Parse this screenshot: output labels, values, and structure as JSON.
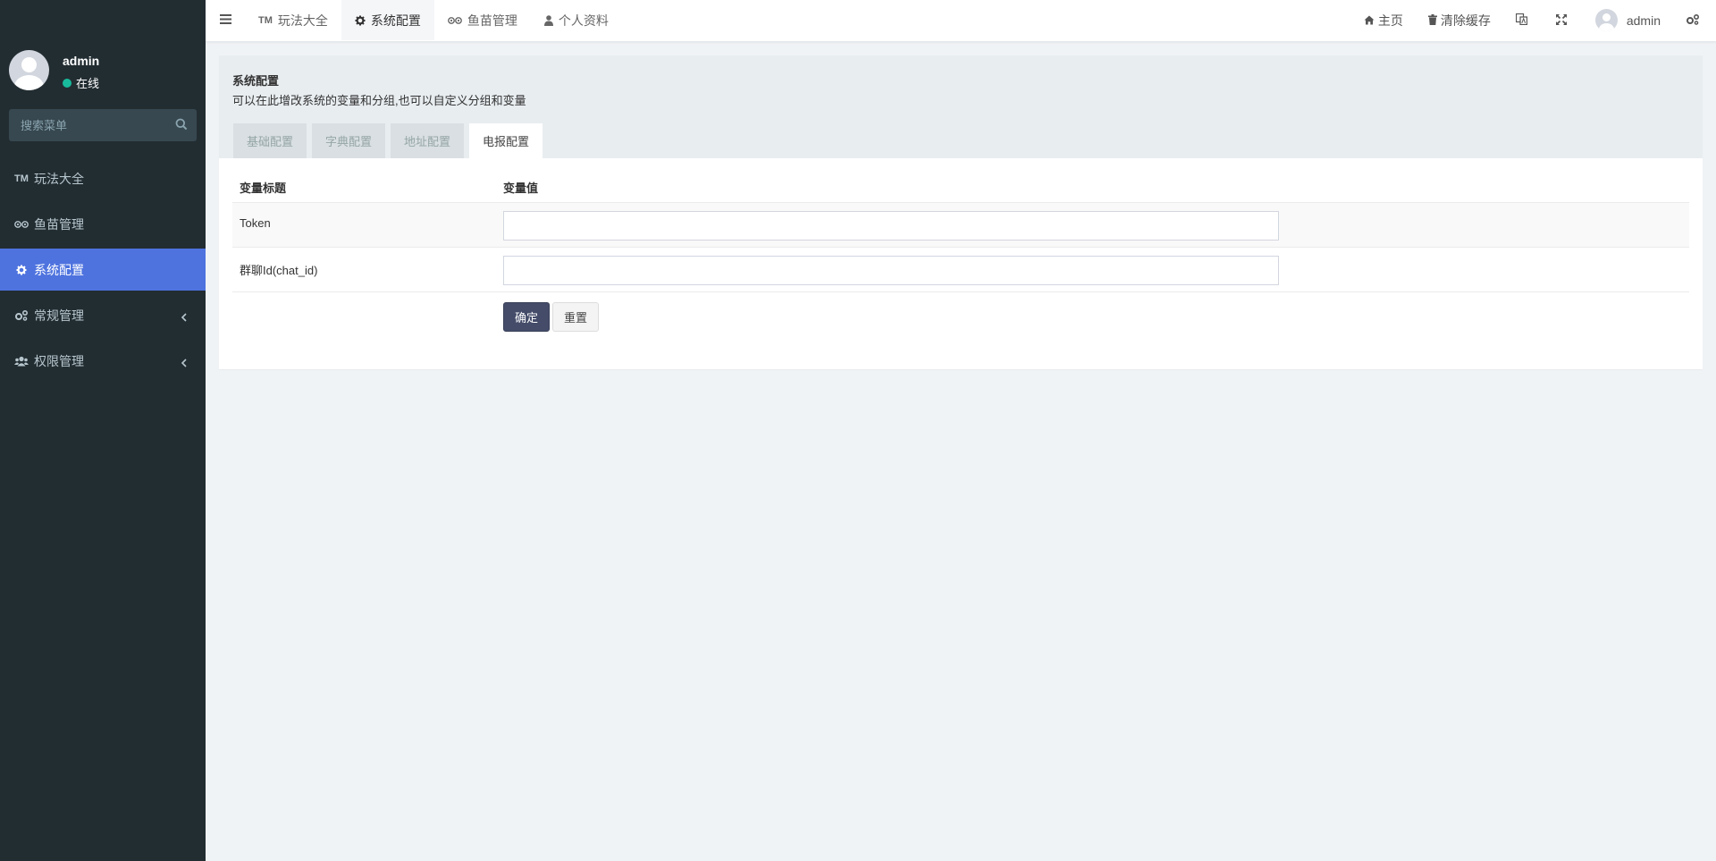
{
  "sidebar": {
    "user": {
      "name": "admin",
      "status": "在线"
    },
    "search": {
      "placeholder": "搜索菜单"
    },
    "menu": [
      {
        "label": "玩法大全",
        "icon": "tm-icon"
      },
      {
        "label": "鱼苗管理",
        "icon": "tripadvisor-icon"
      },
      {
        "label": "系统配置",
        "icon": "gear-icon",
        "active": true
      },
      {
        "label": "常规管理",
        "icon": "cogs-icon",
        "has_children": true
      },
      {
        "label": "权限管理",
        "icon": "users-icon",
        "has_children": true
      }
    ]
  },
  "topbar": {
    "tabs": [
      {
        "label": "玩法大全",
        "icon": "tm-icon"
      },
      {
        "label": "系统配置",
        "icon": "gear-icon",
        "active": true
      },
      {
        "label": "鱼苗管理",
        "icon": "tripadvisor-icon"
      },
      {
        "label": "个人资料",
        "icon": "user-icon"
      }
    ],
    "right": {
      "home": "主页",
      "clear_cache": "清除缓存",
      "username": "admin"
    }
  },
  "panel": {
    "title": "系统配置",
    "description": "可以在此增改系统的变量和分组,也可以自定义分组和变量",
    "tabs": [
      "基础配置",
      "字典配置",
      "地址配置",
      "电报配置"
    ],
    "active_tab": "电报配置",
    "table": {
      "headers": [
        "变量标题",
        "变量值"
      ],
      "rows": [
        {
          "label": "Token",
          "value": ""
        },
        {
          "label": "群聊Id(chat_id)",
          "value": ""
        }
      ]
    },
    "buttons": {
      "submit": "确定",
      "reset": "重置"
    }
  },
  "colors": {
    "sidebar_bg": "#222d32",
    "sidebar_active": "#4e73df",
    "status_online": "#18bc9c",
    "primary_button": "#444c69",
    "content_bg": "#f0f3f6"
  }
}
